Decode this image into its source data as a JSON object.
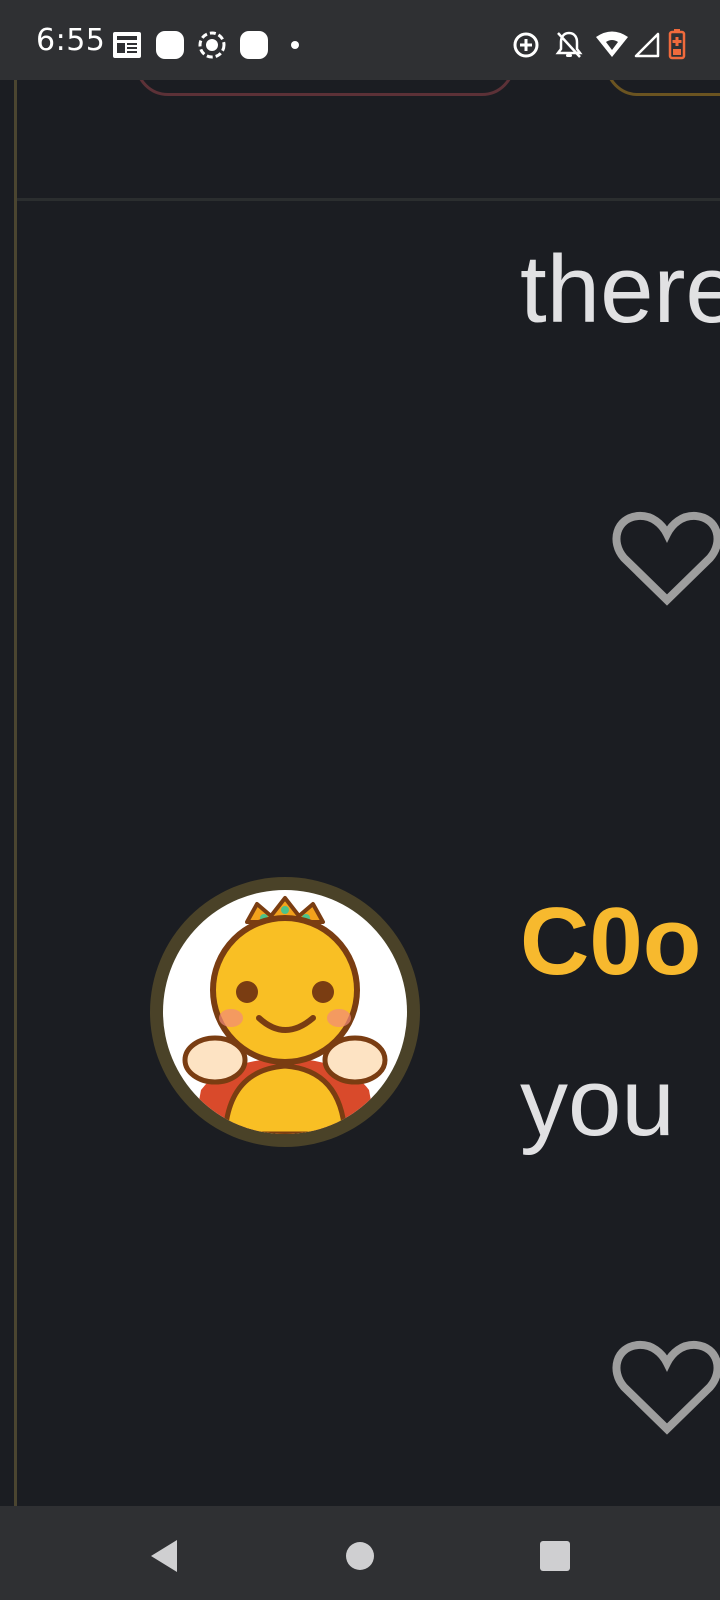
{
  "status_bar": {
    "time": "6:55",
    "left_icons": [
      "news-icon",
      "app-icon",
      "screen-record-icon",
      "app-icon",
      "notification-dot-icon"
    ],
    "right_icons": [
      "data-saver-icon",
      "notifications-off-icon",
      "wifi-icon",
      "cell-signal-icon",
      "battery-low-icon"
    ]
  },
  "feed": {
    "comment_1_text": "there",
    "comment_2_username": "C0o",
    "comment_2_text": "you"
  },
  "colors": {
    "background": "#1b1d22",
    "username": "#f7b92e",
    "text": "#e1e1e3",
    "heart": "#9e9e9e"
  },
  "nav_bar": {
    "buttons": [
      "back-icon",
      "home-icon",
      "recents-icon"
    ]
  }
}
